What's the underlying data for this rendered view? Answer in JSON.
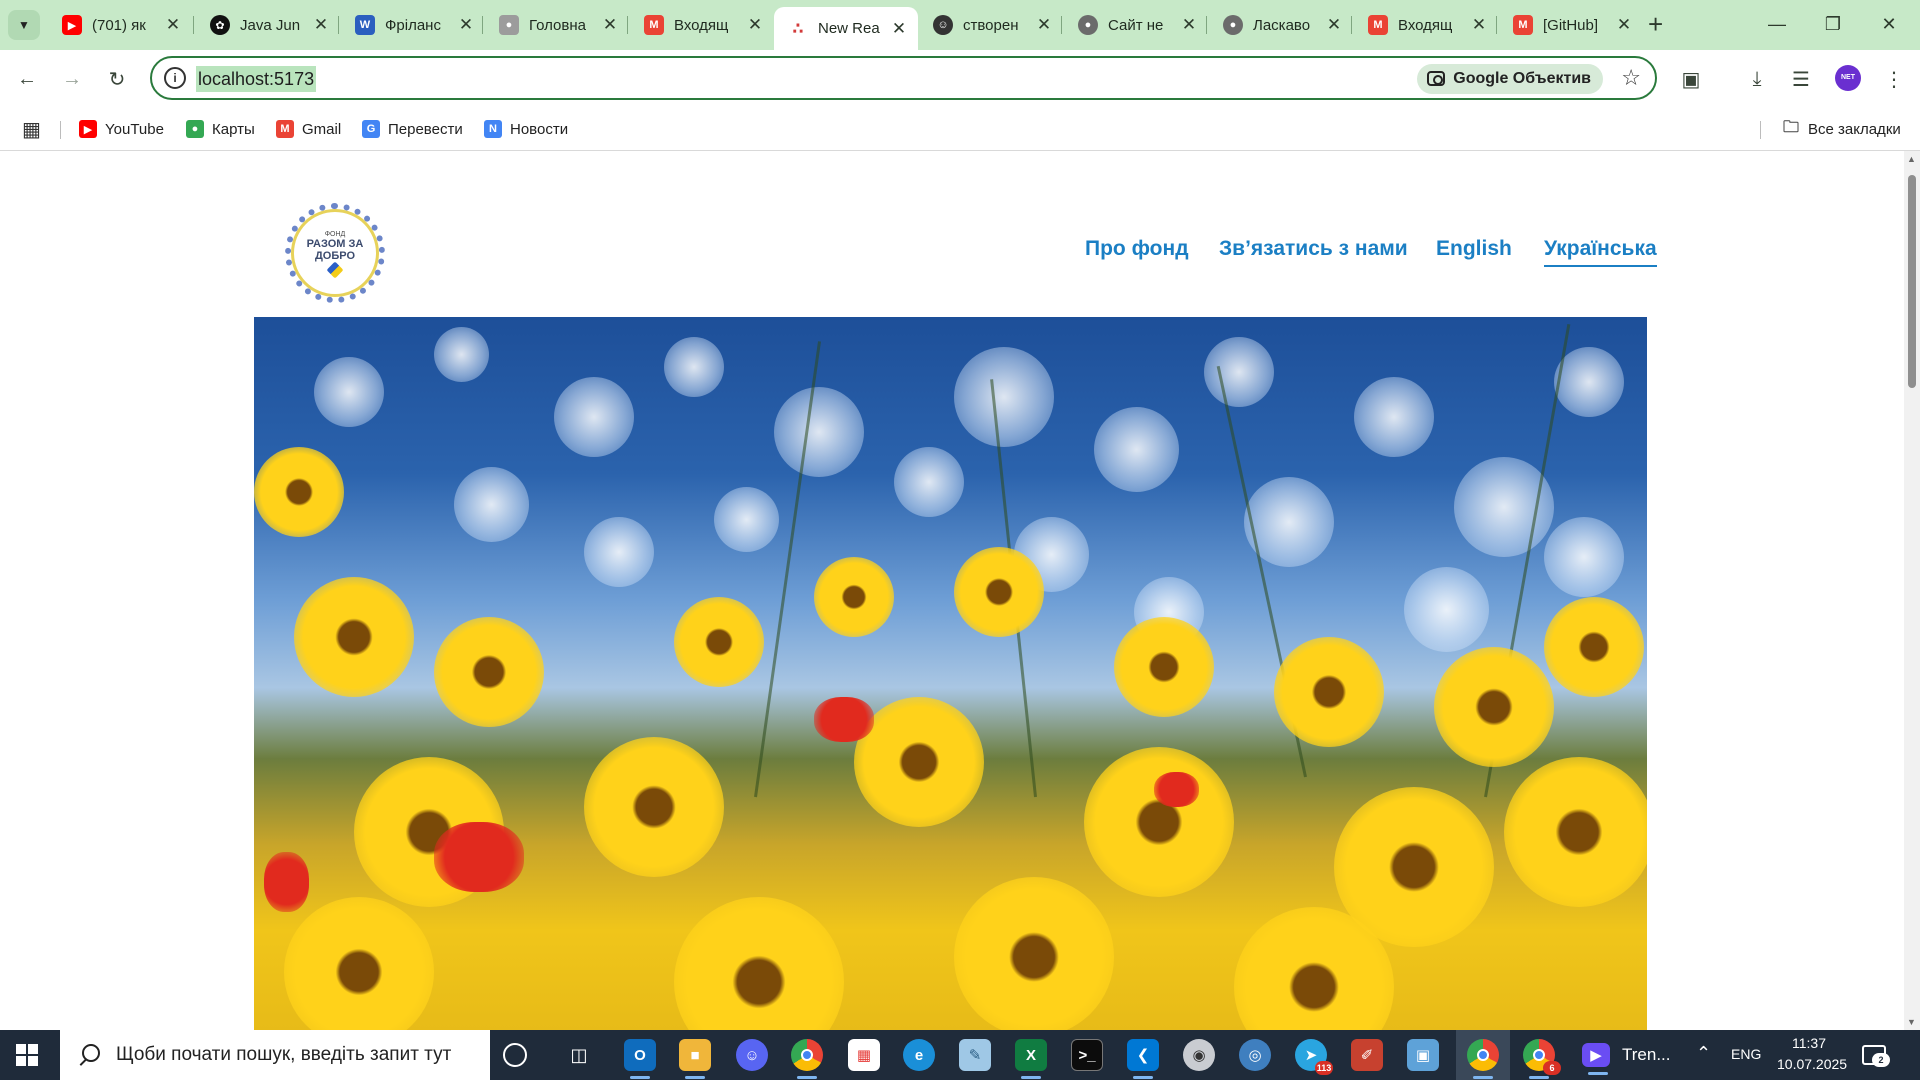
{
  "browser": {
    "tabs": [
      {
        "title": "(701) як",
        "icon": "youtube-icon",
        "color": "#ff0000"
      },
      {
        "title": "Java Jun",
        "icon": "openai-icon",
        "color": "#111111"
      },
      {
        "title": "Фріланс",
        "icon": "word-icon",
        "color": "#2b5fbf"
      },
      {
        "title": "Головна",
        "icon": "page-icon",
        "color": "#8a8a8a"
      },
      {
        "title": "Входящ",
        "icon": "gmail-icon",
        "color": "#ea4335"
      },
      {
        "title": "New Rea",
        "icon": "dots-icon",
        "color": "#d23a3a"
      },
      {
        "title": "створен",
        "icon": "copilot-icon",
        "color": "#333333"
      },
      {
        "title": "Сайт не",
        "icon": "globe-icon",
        "color": "#6b6b6b"
      },
      {
        "title": "Ласкаво",
        "icon": "globe-icon",
        "color": "#6b6b6b"
      },
      {
        "title": "Входящ",
        "icon": "gmail-icon",
        "color": "#ea4335"
      },
      {
        "title": "[GitHub]",
        "icon": "gmail-icon",
        "color": "#ea4335"
      }
    ],
    "active_tab_index": 5,
    "address": "localhost:5173",
    "lens_label": "Google Объектив",
    "profile_label": "NET",
    "bookmarks": [
      {
        "label": "YouTube",
        "icon": "youtube-icon",
        "color": "#ff0000"
      },
      {
        "label": "Карты",
        "icon": "maps-icon",
        "color": "#34a853"
      },
      {
        "label": "Gmail",
        "icon": "gmail-icon",
        "color": "#ea4335"
      },
      {
        "label": "Перевести",
        "icon": "translate-icon",
        "color": "#4285f4"
      },
      {
        "label": "Новости",
        "icon": "news-icon",
        "color": "#4285f4"
      }
    ],
    "all_bookmarks_label": "Все закладки"
  },
  "site": {
    "logo": {
      "line1": "ФОНД",
      "line2": "РАЗОМ ЗА",
      "line3": "ДОБРО"
    },
    "nav": [
      "Про фонд",
      "Зв’язатись з нами",
      "English",
      "Українська"
    ],
    "current_nav": "Українська",
    "hero_alt": "yellow flowers with blue bokeh sky"
  },
  "taskbar": {
    "search_placeholder": "Щоби почати пошук, введіть запит тут",
    "telegram_badge": "113",
    "chrome_badge": "6",
    "zoom_label": "Tren...",
    "lang": "ENG",
    "time": "11:37",
    "date": "10.07.2025",
    "notifications": "2"
  },
  "colors": {
    "chrome_bg": "#c7e9c8",
    "nav_link": "#1b7fc4",
    "taskbar_bg": "#1f2b3a"
  }
}
